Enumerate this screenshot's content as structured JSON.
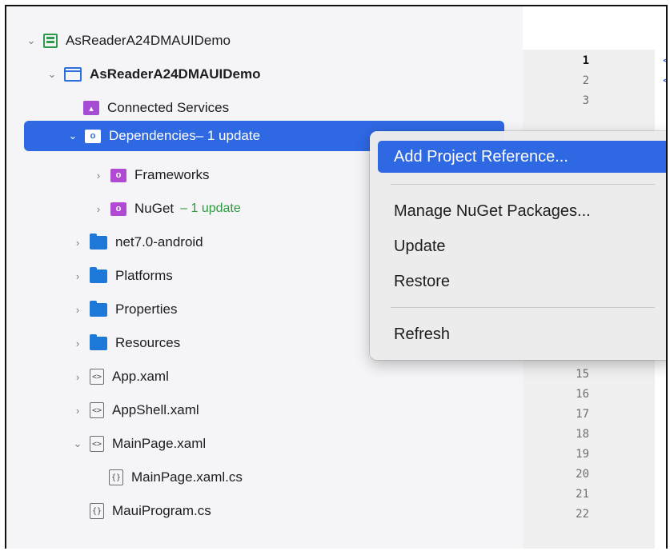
{
  "tree": {
    "solution": {
      "label": "AsReaderA24DMAUIDemo"
    },
    "project": {
      "label": "AsReaderA24DMAUIDemo"
    },
    "connected_services": {
      "label": "Connected Services"
    },
    "dependencies": {
      "label": "Dependencies",
      "badge": " – 1 update"
    },
    "frameworks": {
      "label": "Frameworks"
    },
    "nuget": {
      "label": "NuGet",
      "badge": "– 1 update"
    },
    "net7_android": {
      "label": "net7.0-android"
    },
    "platforms": {
      "label": "Platforms"
    },
    "properties": {
      "label": "Properties"
    },
    "resources": {
      "label": "Resources"
    },
    "app_xaml": {
      "label": "App.xaml"
    },
    "appshell_xaml": {
      "label": "AppShell.xaml"
    },
    "mainpage_xaml": {
      "label": "MainPage.xaml"
    },
    "mainpage_cs": {
      "label": "MainPage.xaml.cs"
    },
    "mauiprogram_cs": {
      "label": "MauiProgram.cs"
    }
  },
  "context_menu": {
    "add_project_reference": "Add Project Reference...",
    "manage_nuget": "Manage NuGet Packages...",
    "update": "Update",
    "restore": "Restore",
    "refresh": "Refresh"
  },
  "editor": {
    "line_numbers_top": [
      "1",
      "2",
      "3"
    ],
    "line_numbers_bottom": [
      "15",
      "16",
      "17",
      "18",
      "19",
      "20",
      "21",
      "22"
    ],
    "code_marks": [
      "<",
      "<"
    ]
  },
  "icons": {
    "file_xaml": "<>",
    "file_cs": "{}"
  },
  "colors": {
    "selection": "#2e68e3",
    "update_badge": "#2a9d3c",
    "folder": "#1e78d7",
    "package": "#b04ad4"
  }
}
